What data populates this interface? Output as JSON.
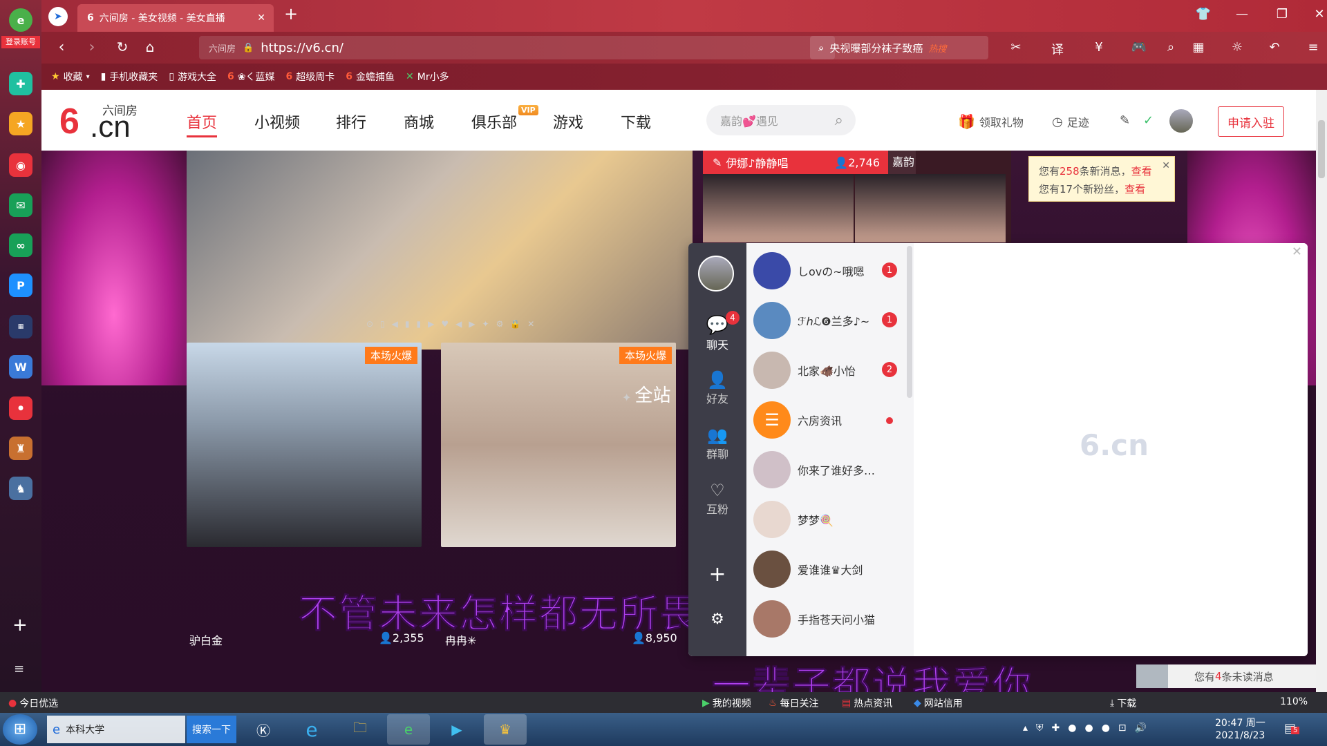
{
  "browser": {
    "login_label": "登录账号",
    "tab_title": "六间房 - 美女视频 - 美女直播",
    "new_tab": "+",
    "url_prefix": "六间房",
    "url": "https://v6.cn/",
    "search_text": "央视曝部分袜子致癌",
    "hot_label": "热搜",
    "bookmarks": [
      "收藏",
      "手机收藏夹",
      "游戏大全",
      "❀く蓝媒",
      "超级周卡",
      "金蟾捕鱼",
      "Mr小多"
    ]
  },
  "site": {
    "logo_six": "6",
    "logo_cn": ".cn",
    "logo_sub": "六间房",
    "nav": [
      "首页",
      "小视频",
      "排行",
      "商城",
      "俱乐部",
      "游戏",
      "下载"
    ],
    "vip": "VIP",
    "search_placeholder": "嘉韵💕遇见",
    "gift_link": "领取礼物",
    "footprint_link": "足迹",
    "join_button": "申请入驻"
  },
  "content": {
    "rank_name": "伊娜♪静静唱",
    "rank_count": "2,746",
    "rank_name2": "嘉韵",
    "notice_line1_pre": "您有",
    "notice_msgs": "258",
    "notice_line1_mid": "条新消息，",
    "notice_view": "查看",
    "notice_line2_pre": "您有",
    "notice_fans": "17",
    "notice_line2_mid": "个新粉丝，",
    "section_title": "全站",
    "cards": [
      {
        "badge": "本场火爆",
        "name": "驴白金",
        "count": "2,355"
      },
      {
        "badge": "本场火爆",
        "name": "冉冉✳",
        "count": "8,950"
      }
    ],
    "lyric1": "不管未来怎样都无所畏惧",
    "lyric2": "一辈子都说我爱你"
  },
  "chat": {
    "side": [
      {
        "label": "聊天",
        "badge": "4"
      },
      {
        "label": "好友"
      },
      {
        "label": "群聊"
      },
      {
        "label": "互粉"
      }
    ],
    "conversations": [
      {
        "name": "しovの~哦嗯",
        "unread": "1",
        "color": "#3a4aa8"
      },
      {
        "name": "ℱℎℒ❻兰多♪~",
        "unread": "1",
        "color": "#5a8ac0"
      },
      {
        "name": "北家🐗小怡",
        "unread": "2",
        "color": "#c8b8b0"
      },
      {
        "name": "六房资讯",
        "dot": true,
        "color": "#ff8a1a"
      },
      {
        "name": "你来了谁好多…",
        "color": "#d0c0c8"
      },
      {
        "name": "梦梦🍭",
        "color": "#e8d8d0"
      },
      {
        "name": "爱谁谁♛大剑",
        "color": "#6a5040"
      },
      {
        "name": "手指苍天问小猫",
        "color": "#a87868"
      }
    ],
    "watermark": "6.cn",
    "unread_pre": "您有",
    "unread_count": "4",
    "unread_post": "条未读消息"
  },
  "statusbar": {
    "left": "今日优选",
    "items": [
      "我的视频",
      "每日关注",
      "热点资讯",
      "网站信用",
      "下载"
    ],
    "zoom": "110%"
  },
  "taskbar": {
    "ie_title": "本科大学",
    "search_btn": "搜索一下",
    "time": "20:47 周一",
    "date": "2021/8/23",
    "notif_count": "5"
  },
  "colors": {
    "accent": "#e8323c",
    "chrome": "#a8303c"
  }
}
